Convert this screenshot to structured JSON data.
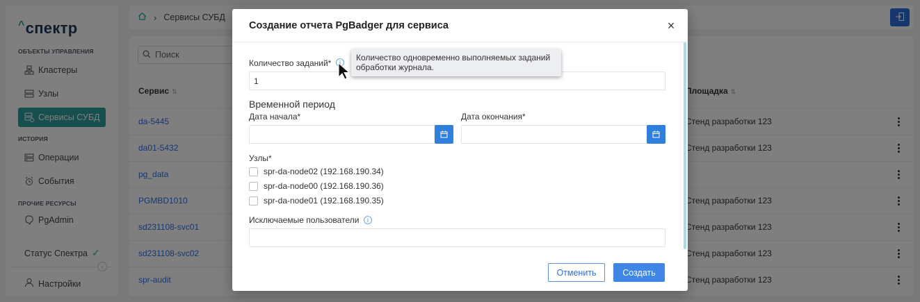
{
  "app": {
    "logo": "спектр",
    "logo_caret": "^",
    "sidebar": {
      "sections": [
        {
          "title": "ОБЪЕКТЫ УПРАВЛЕНИЯ"
        },
        {
          "title": "ИСТОРИЯ"
        },
        {
          "title": "ПРОЧИЕ РЕСУРСЫ"
        }
      ],
      "items": [
        {
          "label": "Кластеры",
          "icon": "cluster-icon"
        },
        {
          "label": "Узлы",
          "icon": "server-icon"
        },
        {
          "label": "Сервисы СУБД",
          "icon": "database-icon",
          "active": true
        },
        {
          "label": "Операции",
          "icon": "operations-icon"
        },
        {
          "label": "События",
          "icon": "events-icon"
        },
        {
          "label": "PgAdmin",
          "icon": "pgadmin-icon"
        }
      ],
      "status_label": "Статус Спектра",
      "settings_label": "Настройки"
    },
    "breadcrumb": {
      "current": "Сервисы СУБД"
    },
    "search_placeholder": "Поиск",
    "table": {
      "columns": {
        "service": "Сервис",
        "site": "Площадка"
      },
      "rows": [
        {
          "service": "da-5445",
          "site": "Стенд разработки 123"
        },
        {
          "service": "da01-5432",
          "site": "Стенд разработки 123"
        },
        {
          "service": "pg_data",
          "site": ""
        },
        {
          "service": "PGMBD1010",
          "site": "Стенд разработки 123"
        },
        {
          "service": "sd231108-svc01",
          "site": "Стенд разработки 123"
        },
        {
          "service": "sd231108-svc02",
          "site": "Стенд разработки 123"
        },
        {
          "service": "spr-audit",
          "site": "Стенд разработки 123"
        }
      ]
    }
  },
  "modal": {
    "title": "Создание отчета PgBadger для сервиса",
    "jobs_label": "Количество заданий*",
    "jobs_value": "1",
    "tooltip": "Количество одновременно выполняемых заданий обработки журнала.",
    "period_heading": "Временной период",
    "start_label": "Дата начала*",
    "end_label": "Дата окончания*",
    "nodes_label": "Узлы*",
    "nodes": [
      "spr-da-node02 (192.168.190.34)",
      "spr-da-node00 (192.168.190.36)",
      "spr-da-node01 (192.168.190.35)"
    ],
    "excluded_users_label": "Исключаемые пользователи",
    "cancel_label": "Отменить",
    "create_label": "Создать"
  },
  "colors": {
    "accent": "#2e9f9f",
    "primary": "#3f86e6",
    "link": "#2f6fe0"
  }
}
